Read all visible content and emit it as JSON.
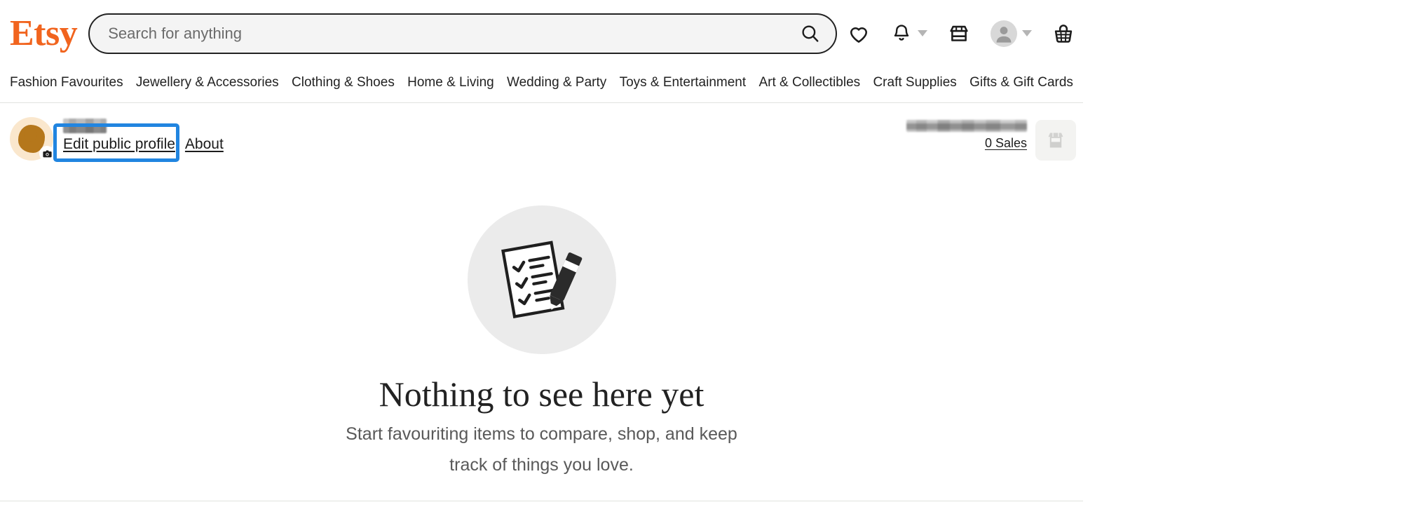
{
  "brand": {
    "logo_text": "Etsy",
    "logo_color": "#F1641E"
  },
  "search": {
    "placeholder": "Search for anything",
    "value": "",
    "icon": "search-icon"
  },
  "header_actions": [
    {
      "name": "favourites",
      "icon": "heart-icon",
      "has_caret": false
    },
    {
      "name": "notifications",
      "icon": "bell-icon",
      "has_caret": true
    },
    {
      "name": "shop-manager",
      "icon": "storefront-icon",
      "has_caret": false
    },
    {
      "name": "account",
      "icon": "avatar-icon",
      "has_caret": true
    },
    {
      "name": "cart",
      "icon": "basket-icon",
      "has_caret": false
    }
  ],
  "nav": {
    "items": [
      {
        "label": "Fashion Favourites"
      },
      {
        "label": "Jewellery & Accessories"
      },
      {
        "label": "Clothing & Shoes"
      },
      {
        "label": "Home & Living"
      },
      {
        "label": "Wedding & Party"
      },
      {
        "label": "Toys & Entertainment"
      },
      {
        "label": "Art & Collectibles"
      },
      {
        "label": "Craft Supplies"
      },
      {
        "label": "Gifts & Gift Cards"
      }
    ]
  },
  "profile": {
    "avatar_icon": "user-avatar-image",
    "avatar_bg_color": "#fae7cd",
    "avatar_shape_color": "#b5771b",
    "camera_icon": "camera-icon",
    "username_redacted": true,
    "links": [
      {
        "label": "Edit public profile",
        "focused": true
      },
      {
        "label": "About",
        "focused": false
      }
    ],
    "focus_ring_color": "#2185e0"
  },
  "shop": {
    "name_redacted": true,
    "sales_label": "0 Sales",
    "thumb_icon": "storefront-placeholder-icon"
  },
  "empty_state": {
    "illustration": "checklist-pencil-icon",
    "circle_color": "#ebebeb",
    "title": "Nothing to see here yet",
    "subtitle": "Start favouriting items to compare, shop, and keep track of things you love."
  }
}
